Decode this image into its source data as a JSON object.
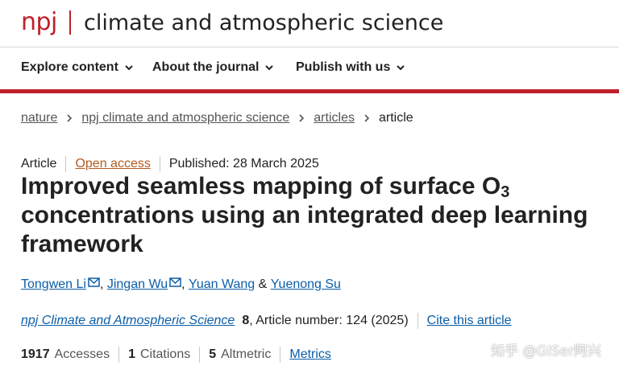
{
  "brand": {
    "short": "npj",
    "title": "climate and atmospheric science"
  },
  "nav": {
    "items": [
      {
        "label": "Explore content"
      },
      {
        "label": "About the journal"
      },
      {
        "label": "Publish with us"
      }
    ]
  },
  "breadcrumb": {
    "items": [
      {
        "label": "nature"
      },
      {
        "label": "npj climate and atmospheric science"
      },
      {
        "label": "articles"
      }
    ],
    "current": "article"
  },
  "article_meta": {
    "type": "Article",
    "access": "Open access",
    "published": "Published: 28 March 2025"
  },
  "title": {
    "before_sub": "Improved seamless mapping of surface O",
    "subscript": "3",
    "after_sub": "concentrations using an integrated deep learning framework"
  },
  "authors": {
    "list": [
      {
        "name": "Tongwen Li",
        "sep": ", "
      },
      {
        "name": "Jingan Wu",
        "sep": ", "
      },
      {
        "name": "Yuan Wang",
        "sep": " & "
      },
      {
        "name": "Yuenong Su"
      }
    ]
  },
  "citation": {
    "journal": "npj Climate and Atmospheric Science",
    "volume": "8",
    "article_number": ", Article number: 124 (2025)",
    "cite_label": "Cite this article"
  },
  "metrics": {
    "accesses": {
      "value": "1917",
      "label": "Accesses"
    },
    "citations": {
      "value": "1",
      "label": "Citations"
    },
    "altmetric": {
      "value": "5",
      "label": "Altmetric"
    },
    "link_label": "Metrics"
  },
  "colors": {
    "brand_red": "#c0202a",
    "link_blue": "#0b5ea8",
    "open_access_orange": "#b45a1e"
  },
  "watermark": "知乎 @GISer阿兴"
}
